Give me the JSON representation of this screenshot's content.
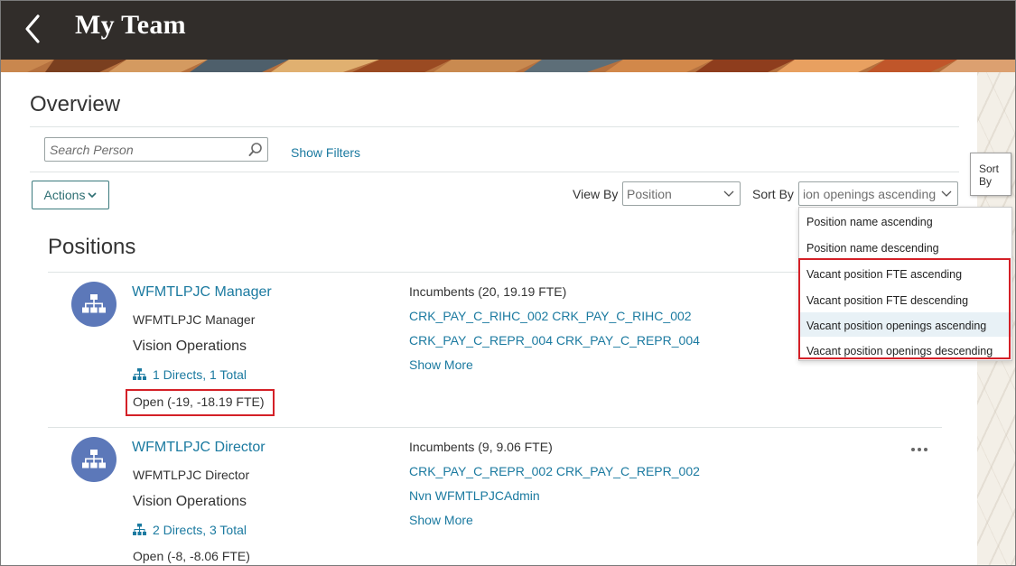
{
  "header": {
    "title": "My Team"
  },
  "overview": {
    "title": "Overview",
    "search_placeholder": "Search Person",
    "show_filters": "Show Filters",
    "actions_label": "Actions"
  },
  "view_by": {
    "label": "View By",
    "value": "Position"
  },
  "sort_by": {
    "label": "Sort By",
    "value": "ion openings ascending",
    "tooltip_line1": "Sort",
    "tooltip_line2": "By",
    "options": [
      "Position name ascending",
      "Position name descending",
      "Vacant position FTE ascending",
      "Vacant position FTE descending",
      "Vacant position openings ascending",
      "Vacant position openings descending"
    ]
  },
  "positions": {
    "title": "Positions",
    "items": [
      {
        "name": "WFMTLPJC Manager",
        "subtitle": "WFMTLPJC Manager",
        "org": "Vision Operations",
        "directs": "1 Directs, 1 Total",
        "open": "Open (-19, -18.19 FTE)",
        "incumbents": "Incumbents (20, 19.19 FTE)",
        "links": [
          "CRK_PAY_C_RIHC_002 CRK_PAY_C_RIHC_002",
          "CRK_PAY_C_REPR_004 CRK_PAY_C_REPR_004"
        ],
        "show_more": "Show More"
      },
      {
        "name": "WFMTLPJC Director",
        "subtitle": "WFMTLPJC Director",
        "org": "Vision Operations",
        "directs": "2 Directs, 3 Total",
        "open": "Open (-8, -8.06 FTE)",
        "incumbents": "Incumbents (9, 9.06 FTE)",
        "links": [
          "CRK_PAY_C_REPR_002 CRK_PAY_C_REPR_002",
          "Nvn WFMTLPJCAdmin"
        ],
        "show_more": "Show More"
      }
    ]
  },
  "colors": {
    "header_bg": "#312d2a",
    "link": "#1b7aa0",
    "avatar": "#5c78b9",
    "highlight": "#d42027"
  },
  "icons": {
    "back": "chevron-left-icon",
    "search": "magnifier-icon",
    "position": "org-chart-icon",
    "more": "ellipsis-icon"
  }
}
